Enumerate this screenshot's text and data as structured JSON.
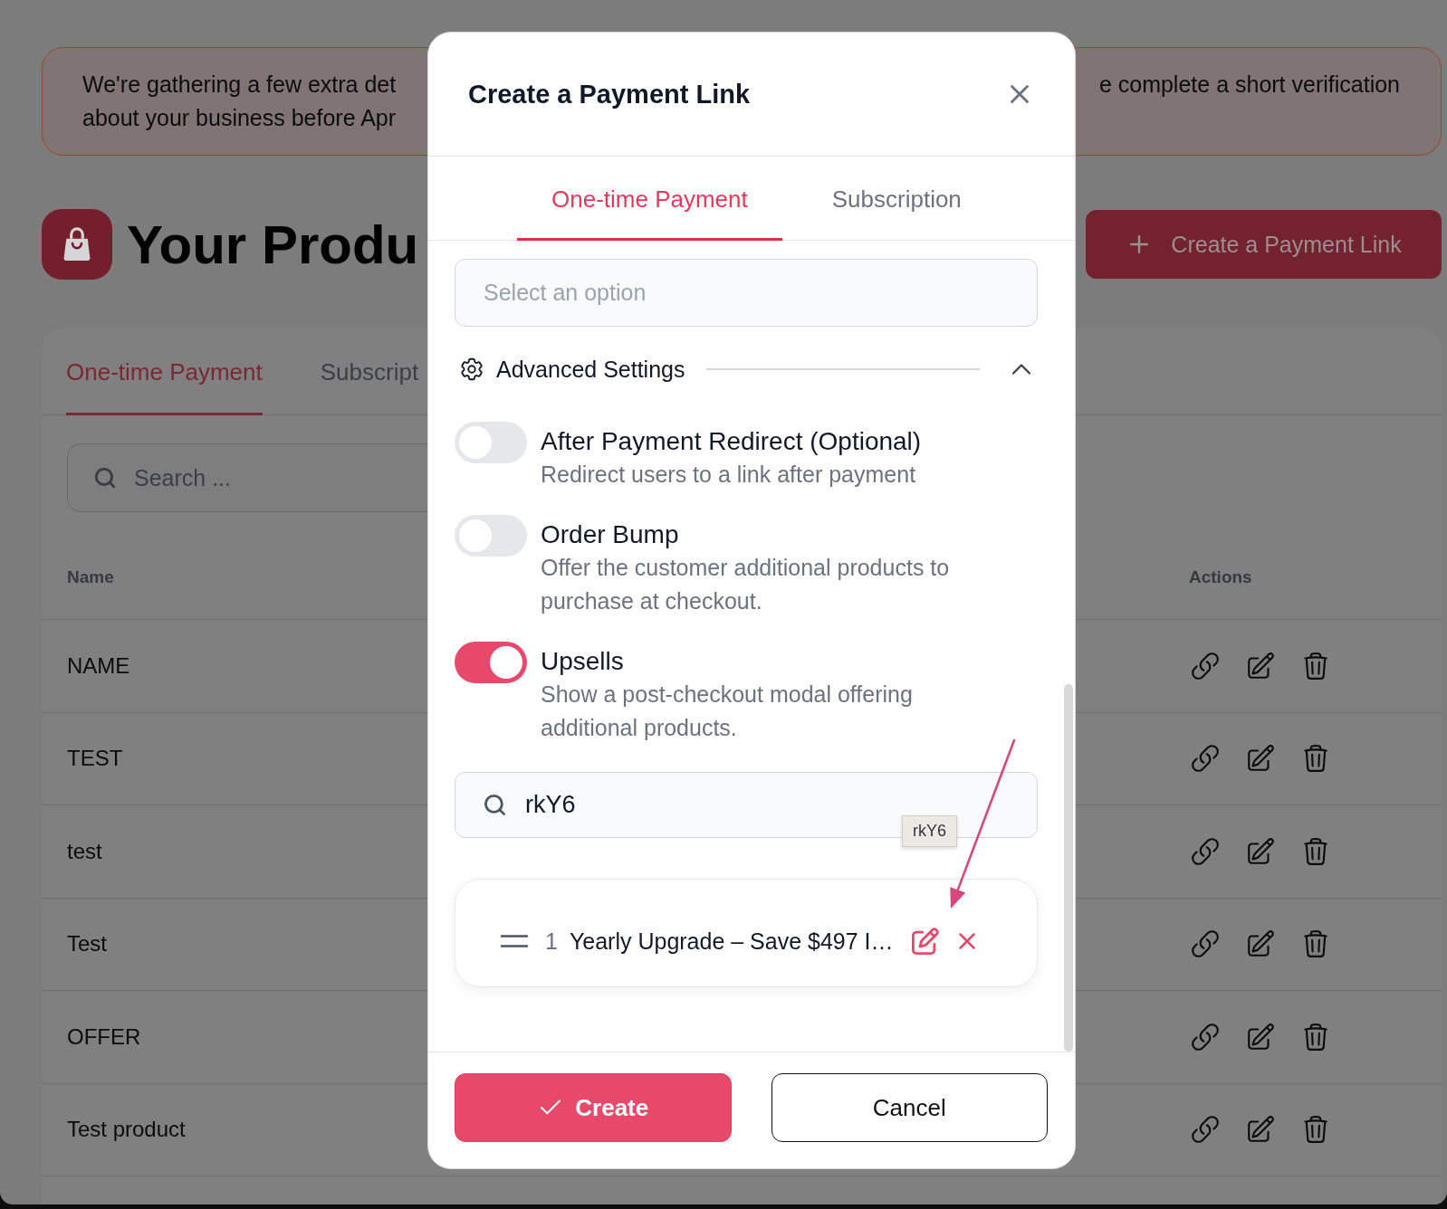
{
  "notice": {
    "left_lines": [
      "We're gathering a few extra det",
      "about your business before Apr"
    ],
    "right_text": "e complete a short verification"
  },
  "page_title": "Your Produ",
  "create_button": {
    "label": "Create a Payment Link"
  },
  "product_tabs": [
    {
      "label": "One-time Payment",
      "selected": true
    },
    {
      "label": "Subscript",
      "selected": false
    }
  ],
  "product_search": {
    "placeholder": "Search ..."
  },
  "products_table": {
    "columns": [
      "Name",
      "Actions"
    ],
    "rows": [
      {
        "name": "NAME"
      },
      {
        "name": "TEST"
      },
      {
        "name": "test"
      },
      {
        "name": "Test"
      },
      {
        "name": "OFFER"
      },
      {
        "name": "Test product"
      }
    ]
  },
  "modal": {
    "title": "Create a Payment Link",
    "tabs": [
      {
        "label": "One-time Payment",
        "selected": true
      },
      {
        "label": "Subscription",
        "selected": false
      }
    ],
    "select": {
      "placeholder": "Select an option"
    },
    "advanced_settings": {
      "label": "Advanced Settings",
      "expanded": true
    },
    "options": [
      {
        "title": "After Payment Redirect (Optional)",
        "description": "Redirect users to a link after payment",
        "on": false
      },
      {
        "title": "Order Bump",
        "description": "Offer the customer additional products to purchase at checkout.",
        "on": false
      },
      {
        "title": "Upsells",
        "description": "Show a post-checkout modal offering additional products.",
        "on": true
      }
    ],
    "upsell_search": {
      "value": "rkY6",
      "tooltip": "rkY6"
    },
    "upsells": [
      {
        "number": "1",
        "title": "Yearly Upgrade – Save $497 I…"
      }
    ],
    "buttons": [
      {
        "label": "Create",
        "kind": "primary"
      },
      {
        "label": "Cancel",
        "kind": "secondary"
      }
    ]
  }
}
